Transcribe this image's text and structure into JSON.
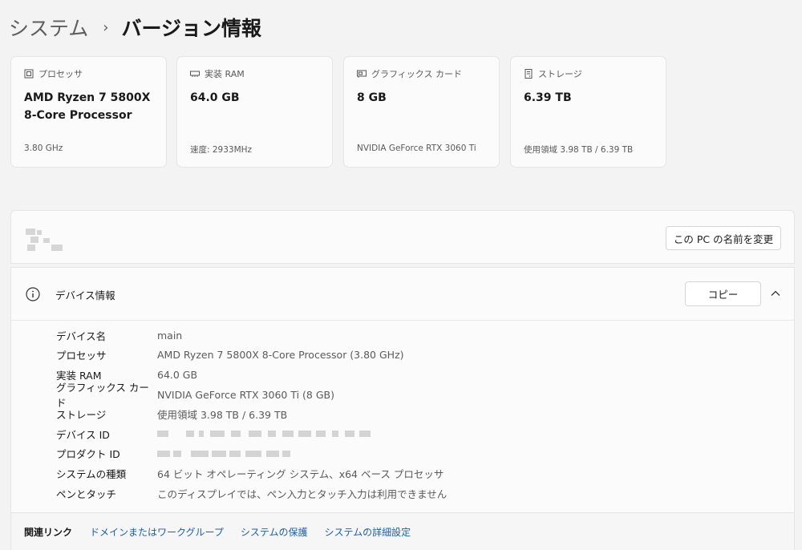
{
  "breadcrumb": {
    "parent": "システム",
    "separator": "›",
    "current": "バージョン情報"
  },
  "spec_cards": [
    {
      "icon": "processor-icon",
      "label": "プロセッサ",
      "value": "AMD Ryzen 7 5800X 8-Core Processor",
      "detail": "3.80 GHz"
    },
    {
      "icon": "memory-icon",
      "label": "実装 RAM",
      "value": "64.0 GB",
      "detail": "速度: 2933MHz"
    },
    {
      "icon": "graphics-card-icon",
      "label": "グラフィックス カード",
      "value": "8 GB",
      "detail": "NVIDIA GeForce RTX 3060 Ti"
    },
    {
      "icon": "storage-icon",
      "label": "ストレージ",
      "value": "6.39 TB",
      "detail": "使用領域 3.98 TB / 6.39 TB"
    }
  ],
  "rename": {
    "button_label": "この PC の名前を変更"
  },
  "device_info": {
    "title": "デバイス情報",
    "copy_label": "コピー",
    "rows": [
      {
        "key": "デバイス名",
        "value": "main"
      },
      {
        "key": "プロセッサ",
        "value": "AMD Ryzen 7 5800X 8-Core Processor (3.80 GHz)"
      },
      {
        "key": "実装 RAM",
        "value": "64.0 GB"
      },
      {
        "key": "グラフィックス カード",
        "value": "NVIDIA GeForce RTX 3060 Ti (8 GB)"
      },
      {
        "key": "ストレージ",
        "value": "使用領域 3.98 TB / 6.39 TB"
      },
      {
        "key": "デバイス ID",
        "value": ""
      },
      {
        "key": "プロダクト ID",
        "value": ""
      },
      {
        "key": "システムの種類",
        "value": "64 ビット オペレーティング システム、x64 ベース プロセッサ"
      },
      {
        "key": "ペンとタッチ",
        "value": "このディスプレイでは、ペン入力とタッチ入力は利用できません"
      }
    ]
  },
  "related": {
    "label": "関連リンク",
    "links": [
      "ドメインまたはワークグループ",
      "システムの保護",
      "システムの詳細設定"
    ]
  },
  "colors": {
    "background": "#f3f3f3",
    "card": "#fbfbfb",
    "link": "#1a5fb4",
    "muted_text": "#5a5a5a"
  }
}
